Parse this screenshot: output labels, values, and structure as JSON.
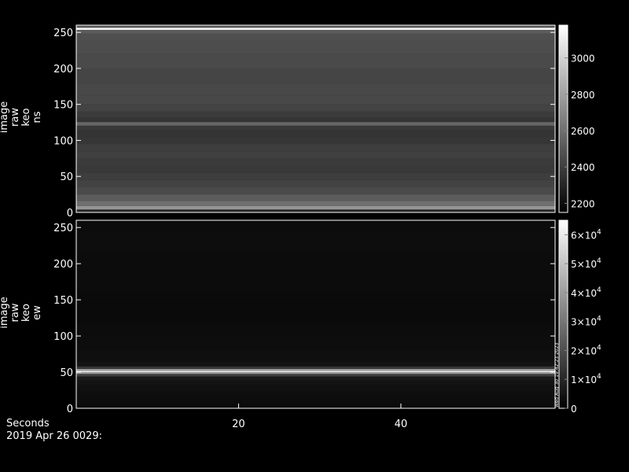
{
  "chart_data": [
    {
      "type": "heatmap",
      "ylabel": [
        "image",
        "raw",
        "keo",
        "ns"
      ],
      "ylim": [
        0,
        260
      ],
      "y_ticks": [
        "0",
        "50",
        "100",
        "150",
        "200",
        "250"
      ],
      "xlim": [
        0,
        59
      ],
      "colorbar": {
        "range": [
          2150,
          3180
        ],
        "ticks": [
          "2200",
          "2400",
          "2600",
          "2800",
          "3000"
        ],
        "tick_values": [
          2200,
          2400,
          2600,
          2800,
          3000
        ]
      },
      "rows": [
        {
          "y": 2,
          "v": 2300
        },
        {
          "y": 6,
          "v": 2750
        },
        {
          "y": 12,
          "v": 2600
        },
        {
          "y": 20,
          "v": 2520
        },
        {
          "y": 30,
          "v": 2450
        },
        {
          "y": 40,
          "v": 2420
        },
        {
          "y": 50,
          "v": 2400
        },
        {
          "y": 60,
          "v": 2380
        },
        {
          "y": 70,
          "v": 2390
        },
        {
          "y": 80,
          "v": 2410
        },
        {
          "y": 90,
          "v": 2400
        },
        {
          "y": 100,
          "v": 2370
        },
        {
          "y": 110,
          "v": 2360
        },
        {
          "y": 118,
          "v": 2380
        },
        {
          "y": 123,
          "v": 2560
        },
        {
          "y": 128,
          "v": 2360
        },
        {
          "y": 135,
          "v": 2390
        },
        {
          "y": 145,
          "v": 2420
        },
        {
          "y": 155,
          "v": 2440
        },
        {
          "y": 170,
          "v": 2440
        },
        {
          "y": 190,
          "v": 2430
        },
        {
          "y": 210,
          "v": 2450
        },
        {
          "y": 230,
          "v": 2460
        },
        {
          "y": 245,
          "v": 2470
        },
        {
          "y": 252,
          "v": 2520
        },
        {
          "y": 255,
          "v": 3150
        },
        {
          "y": 258,
          "v": 2500
        }
      ]
    },
    {
      "type": "heatmap",
      "ylabel": [
        "image",
        "raw",
        "keo",
        "ew"
      ],
      "ylim": [
        0,
        260
      ],
      "y_ticks": [
        "0",
        "50",
        "100",
        "150",
        "200",
        "250"
      ],
      "xlim": [
        0,
        59
      ],
      "x_ticks": [
        20,
        40
      ],
      "xlabel": "Seconds",
      "colorbar": {
        "range": [
          0,
          65000
        ],
        "ticks": [
          "0",
          "1×10",
          "2×10",
          "3×10",
          "4×10",
          "5×10",
          "6×10"
        ],
        "tick_values": [
          0,
          10000,
          20000,
          30000,
          40000,
          50000,
          60000
        ],
        "exponent": "4"
      },
      "rows": [
        {
          "y": 2,
          "v": 2600
        },
        {
          "y": 10,
          "v": 3400
        },
        {
          "y": 20,
          "v": 3600
        },
        {
          "y": 28,
          "v": 4200
        },
        {
          "y": 36,
          "v": 5200
        },
        {
          "y": 42,
          "v": 7000
        },
        {
          "y": 46,
          "v": 16000
        },
        {
          "y": 49,
          "v": 40000
        },
        {
          "y": 51,
          "v": 60000
        },
        {
          "y": 53,
          "v": 40000
        },
        {
          "y": 56,
          "v": 14000
        },
        {
          "y": 60,
          "v": 5000
        },
        {
          "y": 70,
          "v": 3700
        },
        {
          "y": 90,
          "v": 3300
        },
        {
          "y": 110,
          "v": 3100
        },
        {
          "y": 125,
          "v": 2600
        },
        {
          "y": 140,
          "v": 2500
        },
        {
          "y": 155,
          "v": 2800
        },
        {
          "y": 170,
          "v": 3100
        },
        {
          "y": 200,
          "v": 3150
        },
        {
          "y": 230,
          "v": 3200
        },
        {
          "y": 258,
          "v": 3150
        }
      ]
    }
  ],
  "side_text": "Wed Aug 30 19:42:23 2023",
  "footer": {
    "seconds_label": "Seconds",
    "date_label": "2019 Apr 26 0029:"
  }
}
